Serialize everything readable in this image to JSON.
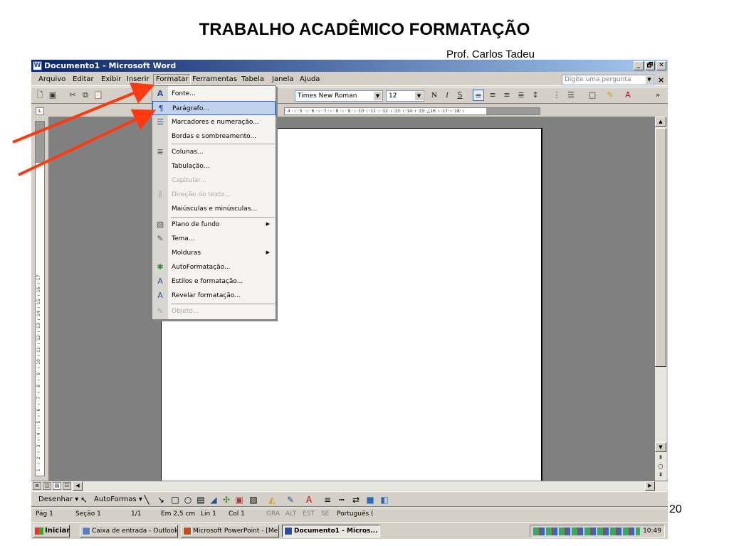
{
  "slide": {
    "title": "TRABALHO ACADÊMICO FORMATAÇÃO",
    "author": "Prof. Carlos Tadeu",
    "page_number": "20"
  },
  "window": {
    "title": "Documento1 - Microsoft Word",
    "controls": [
      "_",
      "🗗",
      "✕"
    ]
  },
  "menubar": {
    "items": [
      "Arquivo",
      "Editar",
      "Exibir",
      "Inserir",
      "Formatar",
      "Ferramentas",
      "Tabela",
      "Janela",
      "Ajuda"
    ],
    "active": "Formatar",
    "ask_placeholder": "Digite uma pergunta"
  },
  "toolbar": {
    "font": "Times New Roman",
    "size": "12",
    "bold": "N",
    "italic": "I",
    "underline": "S"
  },
  "ruler": {
    "h_labels": "· 4 · ı · 5 · ı · 6 · ı · 7 · ı · 8 · ı · 9 · ı ·10· ı ·11· ı ·12· ı ·13· ı ·14· ı ·15· △16· ı ·17· ı ·18· ı",
    "v_labels": "· 1 · ı · 2 · ı · 3 · ı · 4 · ı · 5 · ı · 6 · ı · 7 · ı · 8 · ı · 9 · ı ·10· ı ·11· ı ·12· ı ·13· ı ·14· ı ·15· ı ·16· ı ·17·"
  },
  "format_menu": {
    "items": [
      {
        "label": "Fonte...",
        "icon": "font-icon",
        "state": "normal"
      },
      {
        "label": "Parágrafo...",
        "icon": "paragraph-icon",
        "state": "selected"
      },
      {
        "label": "Marcadores e numeração...",
        "icon": "bullets-icon",
        "state": "normal"
      },
      {
        "label": "Bordas e sombreamento...",
        "icon": "",
        "state": "normal"
      },
      {
        "label": "Colunas...",
        "icon": "columns-icon",
        "state": "normal"
      },
      {
        "label": "Tabulação...",
        "icon": "",
        "state": "normal"
      },
      {
        "label": "Capitular...",
        "icon": "",
        "state": "disabled"
      },
      {
        "label": "Direção do texto...",
        "icon": "text-direction-icon",
        "state": "disabled"
      },
      {
        "label": "Maiúsculas e minúsculas...",
        "icon": "",
        "state": "normal"
      },
      {
        "label": "Plano de fundo",
        "icon": "background-icon",
        "state": "submenu"
      },
      {
        "label": "Tema...",
        "icon": "theme-icon",
        "state": "normal"
      },
      {
        "label": "Molduras",
        "icon": "",
        "state": "submenu"
      },
      {
        "label": "AutoFormatação...",
        "icon": "autoformat-icon",
        "state": "normal"
      },
      {
        "label": "Estilos e formatação...",
        "icon": "styles-icon",
        "state": "normal"
      },
      {
        "label": "Revelar formatação...",
        "icon": "reveal-formatting-icon",
        "state": "normal"
      },
      {
        "label": "Objeto...",
        "icon": "object-icon",
        "state": "disabled"
      }
    ]
  },
  "drawing_toolbar": {
    "draw": "Desenhar ▾",
    "autoshapes": "AutoFormas ▾"
  },
  "statusbar": {
    "page": "Pág 1",
    "section": "Seção 1",
    "pages": "1/1",
    "position": "Em 2,5 cm",
    "line": "Lin 1",
    "col": "Col 1",
    "rec": "GRA",
    "trk": "ALT",
    "ext": "EST",
    "ovr": "SE",
    "language": "Português ("
  },
  "taskbar": {
    "start": "Iniciar",
    "tasks": [
      "Caixa de entrada - Outlook...",
      "Microsoft PowerPoint - [Me...",
      "Documento1 - Micros..."
    ],
    "clock": "10:49"
  },
  "colors": {
    "title_bar": "#0a246a",
    "arrow": "#ff3a10",
    "menu_highlight": "#c1d2ee",
    "face": "#d4d0c8"
  }
}
